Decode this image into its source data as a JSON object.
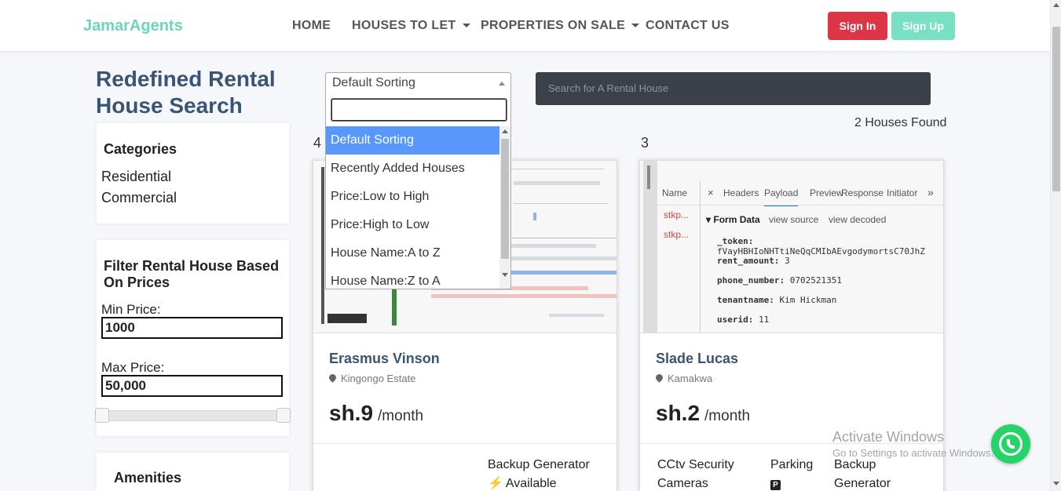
{
  "nav": {
    "brand": "JamarAgents",
    "items": [
      {
        "label": "HOME",
        "dropdown": false
      },
      {
        "label": "HOUSES TO LET",
        "dropdown": true
      },
      {
        "label": "PROPERTIES ON SALE",
        "dropdown": true
      },
      {
        "label": "CONTACT US",
        "dropdown": false
      }
    ],
    "signin": "Sign In",
    "signup": "Sign Up"
  },
  "page_title": "Redefined Rental House Search",
  "sidebar": {
    "categories_title": "Categories",
    "categories": [
      "Residential",
      "Commercial"
    ],
    "filter_title": "Filter Rental House Based On Prices",
    "min_label": "Min Price:",
    "min_value": "1000",
    "max_label": "Max Price:",
    "max_value": "50,000",
    "amenities_title": "Amenities"
  },
  "sort": {
    "selected": "Default Sorting",
    "options": [
      "Default Sorting",
      "Recently Added Houses",
      "Price:Low to High",
      "Price:High to Low",
      "House Name:A to Z",
      "House Name:Z to A"
    ]
  },
  "search": {
    "placeholder": "Search for A Rental House"
  },
  "results_count": "2 Houses Found",
  "listings": [
    {
      "number": "4",
      "name": "Erasmus Vinson",
      "location": "Kingongo Estate",
      "price": "sh.9",
      "per": "/month",
      "amenities": [
        {
          "label": "Backup Generator",
          "status": "Available"
        }
      ]
    },
    {
      "number": "3",
      "name": "Slade Lucas",
      "location": "Kamakwa",
      "price": "sh.2",
      "per": "/month",
      "amenities": [
        {
          "label": "CCtv Security Cameras"
        },
        {
          "label": "Parking"
        },
        {
          "label": "Backup Generator"
        }
      ],
      "devtools": {
        "name_col": "Name",
        "items": [
          "stkp...",
          "stkp..."
        ],
        "tabs": [
          "Headers",
          "Payload",
          "Preview",
          "Response",
          "Initiator"
        ],
        "form_data_title": "Form Data",
        "view_source": "view source",
        "view_decoded": "view decoded",
        "fields": [
          {
            "key": "_token:",
            "value": "fVayHBHIoNHTtiNeQqCMIbAEvgodymortsC70JhZ"
          },
          {
            "key": "rent_amount:",
            "value": "3"
          },
          {
            "key": "phone_number:",
            "value": "0702521351"
          },
          {
            "key": "tenantname:",
            "value": "Kim Hickman"
          },
          {
            "key": "userid:",
            "value": "11"
          }
        ]
      }
    }
  ],
  "watermark": {
    "line1": "Activate Windows",
    "line2": "Go to Settings to activate Windows."
  }
}
